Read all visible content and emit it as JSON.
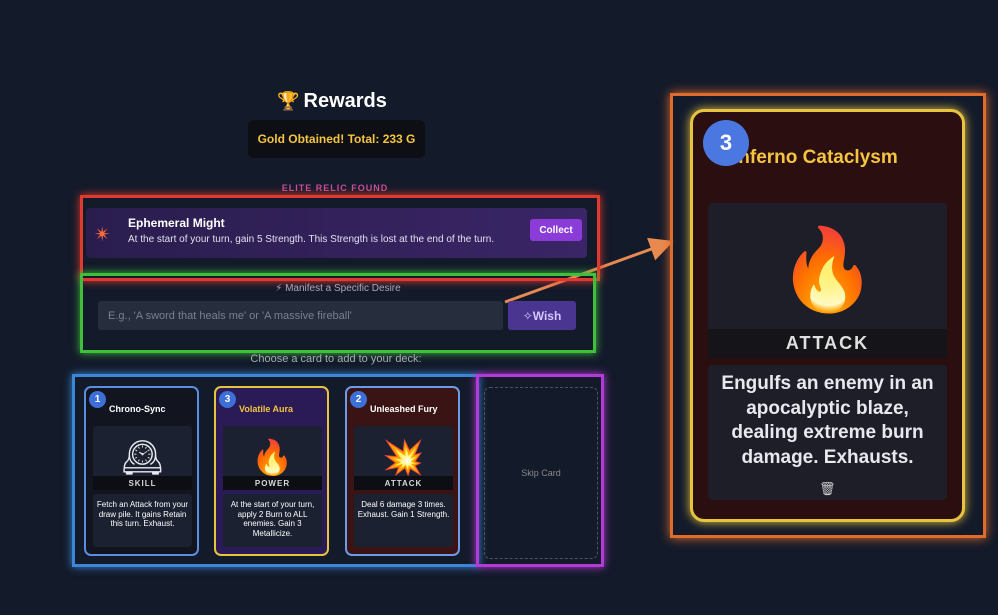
{
  "title": {
    "icon": "trophy-icon",
    "text": "Rewards"
  },
  "gold": "Gold Obtained! Total: 233 G",
  "elite_label": "ELITE RELIC FOUND",
  "relic": {
    "icon": "burst-icon",
    "name": "Ephemeral Might",
    "description": "At the start of your turn, gain 5 Strength. This Strength is lost at the end of the turn.",
    "collect_label": "Collect"
  },
  "wish": {
    "label": "Manifest a Specific Desire",
    "placeholder": "E.g., 'A sword that heals me' or 'A massive fireball'",
    "button_label": "Wish"
  },
  "choose_label": "Choose a card to add to your deck:",
  "cards": [
    {
      "cost": "1",
      "name": "Chrono-Sync",
      "art": "clock",
      "type": "SKILL",
      "description": "Fetch an Attack from your draw pile. It gains Retain this turn. Exhaust."
    },
    {
      "cost": "3",
      "name": "Volatile Aura",
      "art": "fire",
      "type": "POWER",
      "description": "At the start of your turn, apply 2 Burn to ALL enemies. Gain 3 Metallicize."
    },
    {
      "cost": "2",
      "name": "Unleashed Fury",
      "art": "burst",
      "type": "ATTACK",
      "description": "Deal 6 damage 3 times. Exhaust. Gain 1 Strength."
    }
  ],
  "skip_label": "Skip Card",
  "zoomed_card": {
    "cost": "3",
    "name": "Inferno Cataclysm",
    "art": "fire",
    "type": "ATTACK",
    "description": "Engulfs an enemy in an apocalyptic blaze, dealing extreme burn damage. Exhausts.",
    "icon": "trash-icon"
  },
  "colors": {
    "red_highlight": "#e03a2f",
    "green_highlight": "#3fbf3a",
    "blue_highlight": "#3a86d8",
    "purple_highlight": "#b43ad8",
    "orange_highlight": "#e06c2c",
    "gold": "#f5c542"
  }
}
